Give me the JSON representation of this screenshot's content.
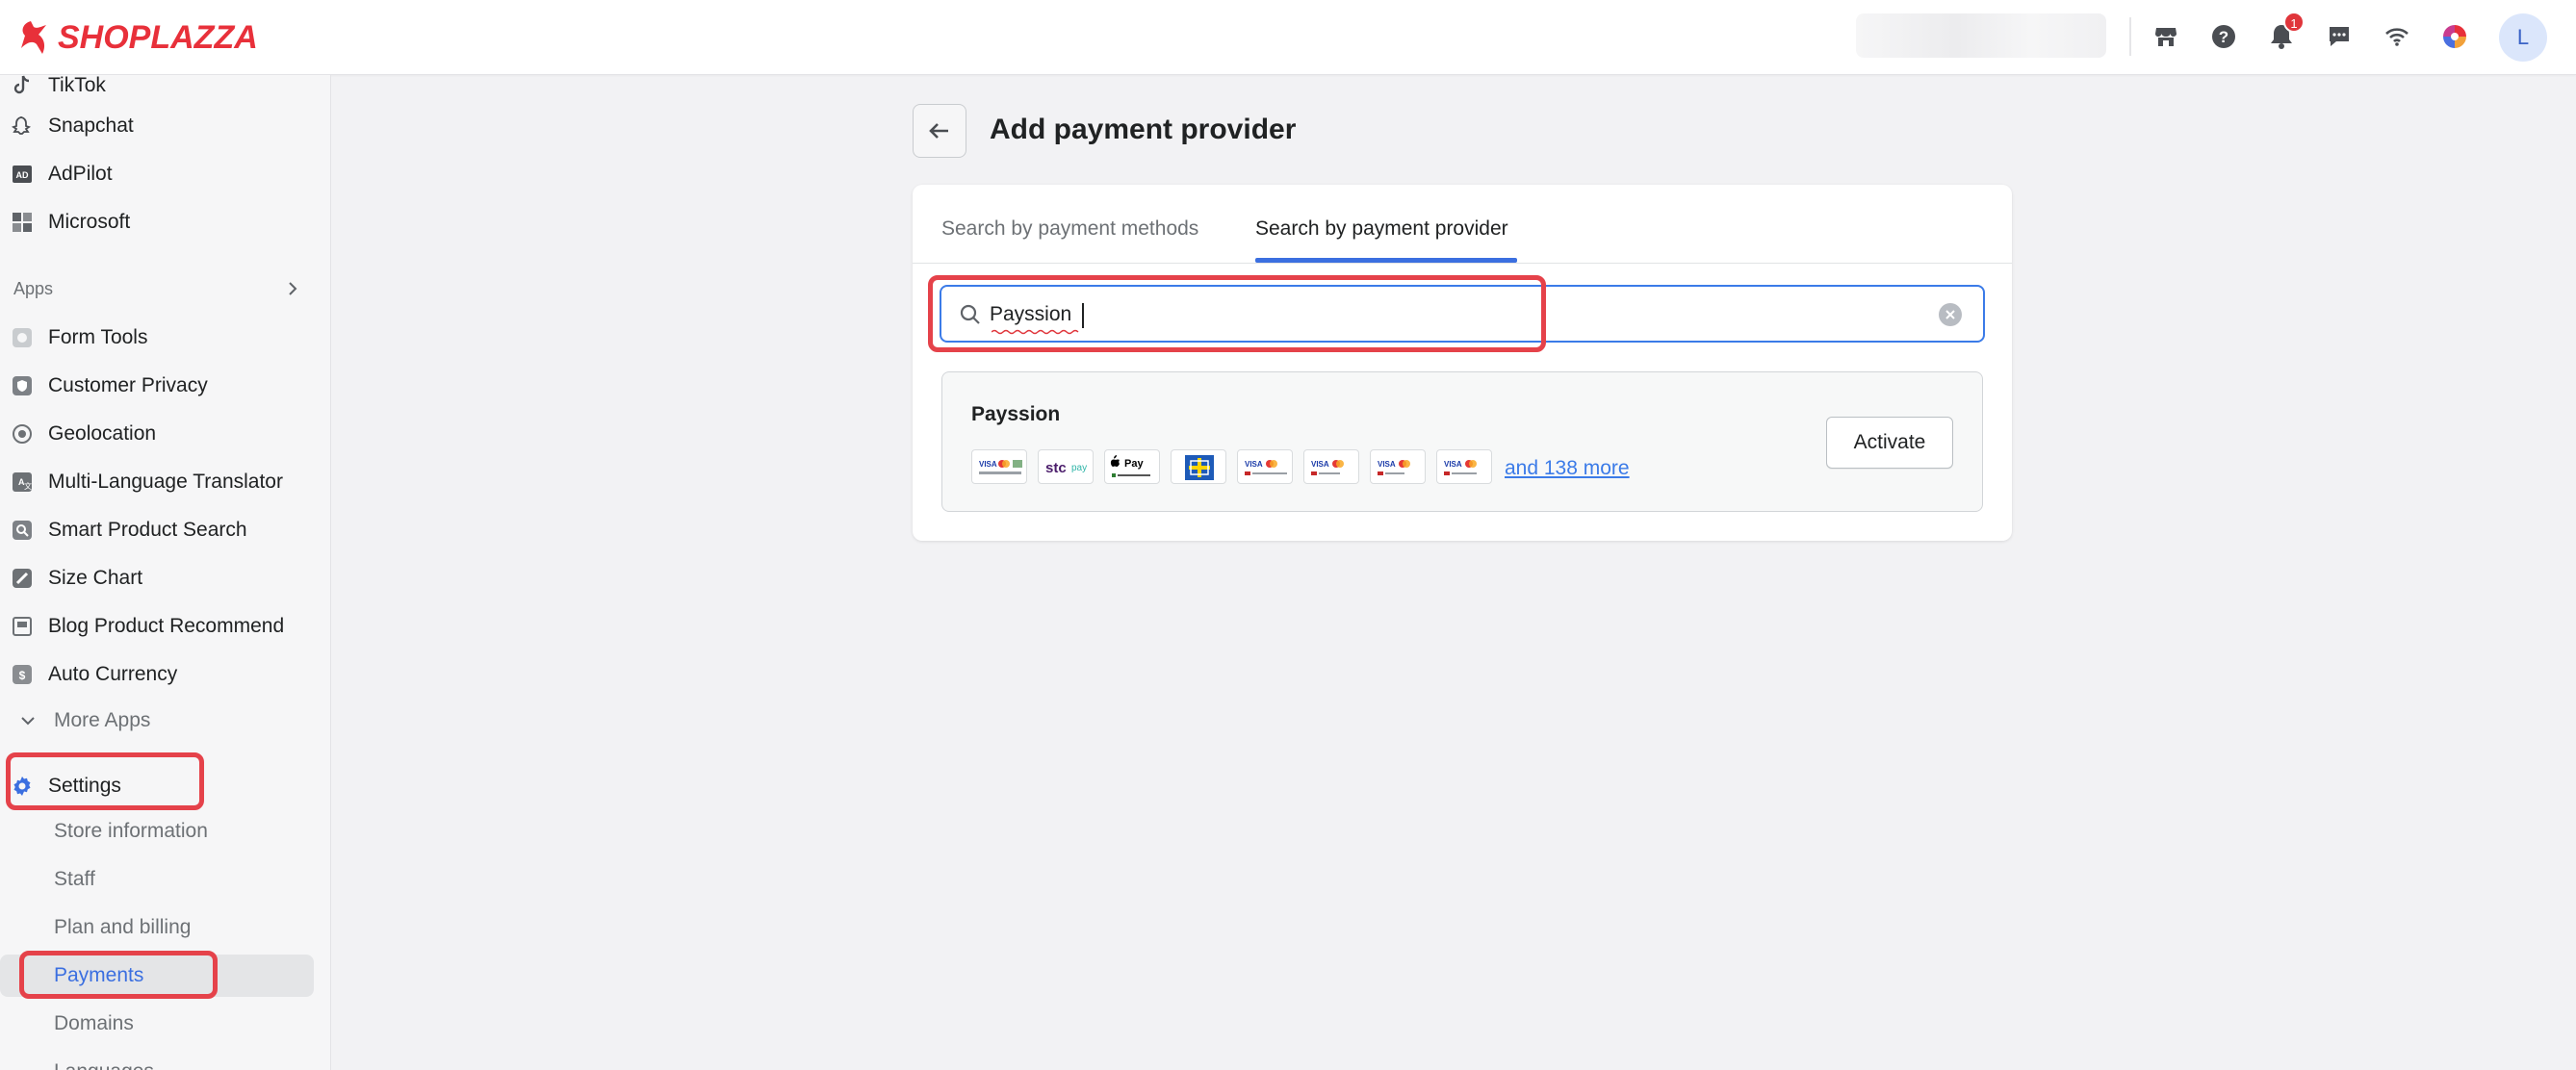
{
  "brand": {
    "name": "SHOPLAZZA",
    "color": "#e8303a"
  },
  "header": {
    "notification_count": "1",
    "avatar_initial": "L",
    "icons": [
      "store-icon",
      "help-icon",
      "bell-icon",
      "chat-icon",
      "wifi-icon",
      "color-wheel-icon"
    ]
  },
  "sidebar": {
    "top_items": [
      {
        "label": "TikTok",
        "icon": "tiktok-icon"
      },
      {
        "label": "Snapchat",
        "icon": "snapchat-icon"
      },
      {
        "label": "AdPilot",
        "icon": "adpilot-icon"
      },
      {
        "label": "Microsoft",
        "icon": "microsoft-icon"
      }
    ],
    "apps_label": "Apps",
    "apps": [
      {
        "label": "Form Tools",
        "icon": "form-icon"
      },
      {
        "label": "Customer Privacy",
        "icon": "shield-icon"
      },
      {
        "label": "Geolocation",
        "icon": "globe-icon"
      },
      {
        "label": "Multi-Language Translator",
        "icon": "translate-icon"
      },
      {
        "label": "Smart Product Search",
        "icon": "search-icon"
      },
      {
        "label": "Size Chart",
        "icon": "ruler-icon"
      },
      {
        "label": "Blog Product Recommend",
        "icon": "blog-icon"
      },
      {
        "label": "Auto Currency",
        "icon": "currency-icon"
      }
    ],
    "more_apps": "More Apps",
    "settings_label": "Settings",
    "settings_items": [
      {
        "label": "Store information"
      },
      {
        "label": "Staff"
      },
      {
        "label": "Plan and billing"
      },
      {
        "label": "Payments",
        "active": true
      },
      {
        "label": "Domains"
      },
      {
        "label": "Languages"
      }
    ],
    "active_color": "#3b6fe0"
  },
  "main": {
    "title": "Add payment provider",
    "tabs": [
      {
        "label": "Search by payment methods",
        "active": false
      },
      {
        "label": "Search by payment provider",
        "active": true
      }
    ],
    "search": {
      "value": "Payssion",
      "placeholder": ""
    },
    "result": {
      "provider": "Payssion",
      "payment_icons": [
        "visa-mastercard-card",
        "stc-pay",
        "apple-pay",
        "boleto",
        "visa-mastercard-card",
        "visa-mastercard-card",
        "visa-mastercard-card",
        "visa-mastercard-card"
      ],
      "more_label": "and 138 more",
      "action_label": "Activate"
    }
  },
  "highlight_color": "#e5424a"
}
